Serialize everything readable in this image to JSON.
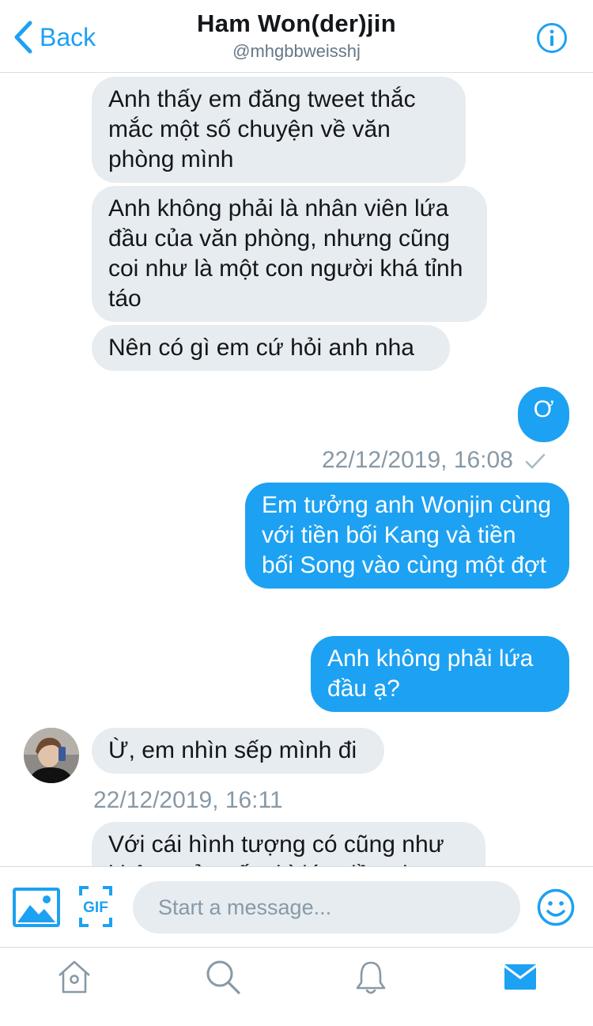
{
  "header": {
    "back_label": "Back",
    "title": "Ham Won(der)jin",
    "handle": "@mhgbbweisshj"
  },
  "conversation": {
    "messages": [
      {
        "from": "them",
        "text": "Anh thấy em đăng tweet thắc mắc một số chuyện về văn phòng mình"
      },
      {
        "from": "them",
        "text": "Anh không phải là nhân viên lứa đầu của văn phòng, nhưng cũng coi như là một con người khá tỉnh táo"
      },
      {
        "from": "them",
        "text": "Nên có gì em cứ hỏi anh nha"
      },
      {
        "from": "me",
        "text": "Ơ"
      },
      {
        "from": "me",
        "text": "Em tưởng anh Wonjin cùng với tiền bối Kang và tiền bối Song vào cùng một đợt"
      },
      {
        "from": "me",
        "text": "Anh không phải lứa đầu ạ?"
      },
      {
        "from": "them",
        "text": "Ừ, em nhìn sếp mình đi"
      },
      {
        "from": "them",
        "text": "Với cái hình tượng có cũng như không của sếp thì lứa đầu ai"
      }
    ],
    "timestamp_sent": "22/12/2019, 16:08",
    "timestamp_received": "22/12/2019, 16:11"
  },
  "composer": {
    "placeholder": "Start a message...",
    "gif_label": "GIF"
  },
  "icons": {
    "back": "chevron-left-icon",
    "info": "info-icon",
    "photo": "image-icon",
    "gif": "gif-icon",
    "emoji": "smiley-icon",
    "home": "home-icon",
    "search": "search-icon",
    "notifications": "bell-icon",
    "messages": "envelope-icon",
    "sent_status": "checkmark-icon"
  },
  "colors": {
    "accent": "#1da1f2",
    "incoming_bubble": "#e6ecf0",
    "muted_text": "#8899a6",
    "inactive_icon": "#8899a6"
  }
}
